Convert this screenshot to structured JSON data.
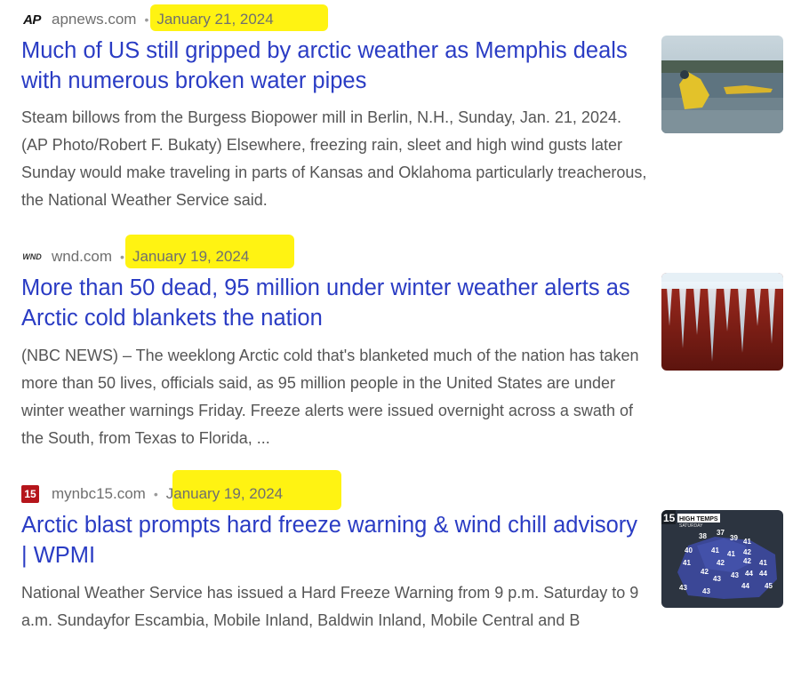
{
  "results": [
    {
      "source": "apnews.com",
      "favicon_text": "AP",
      "date": "January 21, 2024",
      "title": "Much of US still gripped by arctic weather as Memphis deals with numerous broken water pipes",
      "snippet": "Steam billows from the Burgess Biopower mill in Berlin, N.H., Sunday, Jan. 21, 2024. (AP Photo/Robert F. Bukaty) Elsewhere, freezing rain, sleet and high wind gusts later Sunday would make traveling in parts of Kansas and Oklahoma particularly treacherous, the National Weather Service said."
    },
    {
      "source": "wnd.com",
      "favicon_text": "WND",
      "date": "January 19, 2024",
      "title": "More than 50 dead, 95 million under winter weather alerts as Arctic cold blankets the nation",
      "snippet": "(NBC NEWS) – The weeklong Arctic cold that's blanketed much of the nation has taken more than 50 lives, officials said, as 95 million people in the United States are under winter weather warnings Friday. Freeze alerts were issued overnight across a swath of the South, from Texas to Florida, ..."
    },
    {
      "source": "mynbc15.com",
      "favicon_text": "15",
      "date": "January 19, 2024",
      "title": "Arctic blast prompts hard freeze warning & wind chill advisory | WPMI",
      "snippet": "National Weather Service has issued a Hard Freeze Warning from 9 p.m. Saturday to 9 a.m. Sundayfor Escambia, Mobile Inland, Baldwin Inland, Mobile Central and B",
      "thumb_labels": {
        "logo": "15",
        "heading": "HIGH TEMPS",
        "subheading": "SATURDAY",
        "temps": [
          "38",
          "37",
          "39",
          "41",
          "40",
          "41",
          "41",
          "42",
          "41",
          "42",
          "42",
          "41",
          "42",
          "44",
          "44",
          "43",
          "43",
          "43",
          "44",
          "45",
          "43"
        ]
      }
    }
  ],
  "colors": {
    "title": "#2a3cc4",
    "highlight": "#fff200",
    "meta": "#6f6f6f"
  }
}
